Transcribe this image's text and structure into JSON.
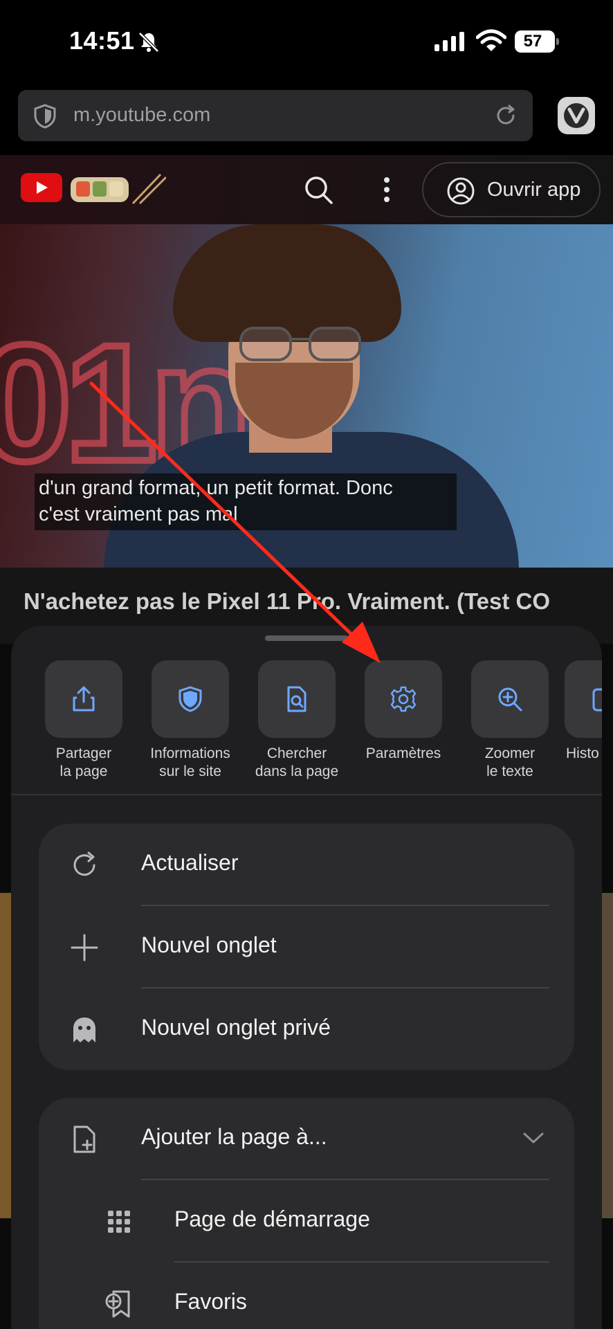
{
  "status": {
    "time": "14:51",
    "battery": "57"
  },
  "browser": {
    "url": "m.youtube.com"
  },
  "youtube": {
    "open_app_label": "Ouvrir app",
    "caption_line1": "d'un grand format, un petit format. Donc",
    "caption_line2": "c'est vraiment pas mal",
    "neon_text": "01n",
    "video_title": "N'achetez pas le Pixel 11 Pro. Vraiment. (Test CO"
  },
  "quick_actions": [
    {
      "label1": "Partager",
      "label2": "la page",
      "icon": "share-icon"
    },
    {
      "label1": "Informations",
      "label2": "sur le site",
      "icon": "shield-icon"
    },
    {
      "label1": "Chercher",
      "label2": "dans la page",
      "icon": "find-in-page-icon"
    },
    {
      "label1": "Paramètres",
      "label2": "",
      "icon": "gear-icon"
    },
    {
      "label1": "Zoomer",
      "label2": "le texte",
      "icon": "zoom-in-icon"
    },
    {
      "label1": "Histo",
      "label2": "",
      "icon": "history-icon"
    }
  ],
  "menu_group1": [
    {
      "label": "Actualiser",
      "icon": "reload-icon"
    },
    {
      "label": "Nouvel onglet",
      "icon": "plus-icon"
    },
    {
      "label": "Nouvel onglet privé",
      "icon": "ghost-icon"
    }
  ],
  "menu_group2": [
    {
      "label": "Ajouter la page à...",
      "icon": "add-page-icon"
    },
    {
      "label": "Page de démarrage",
      "icon": "grid-icon"
    },
    {
      "label": "Favoris",
      "icon": "bookmark-add-icon"
    }
  ],
  "colors": {
    "accent": "#6ea8ff",
    "annotation_arrow": "#ff2a1a"
  }
}
